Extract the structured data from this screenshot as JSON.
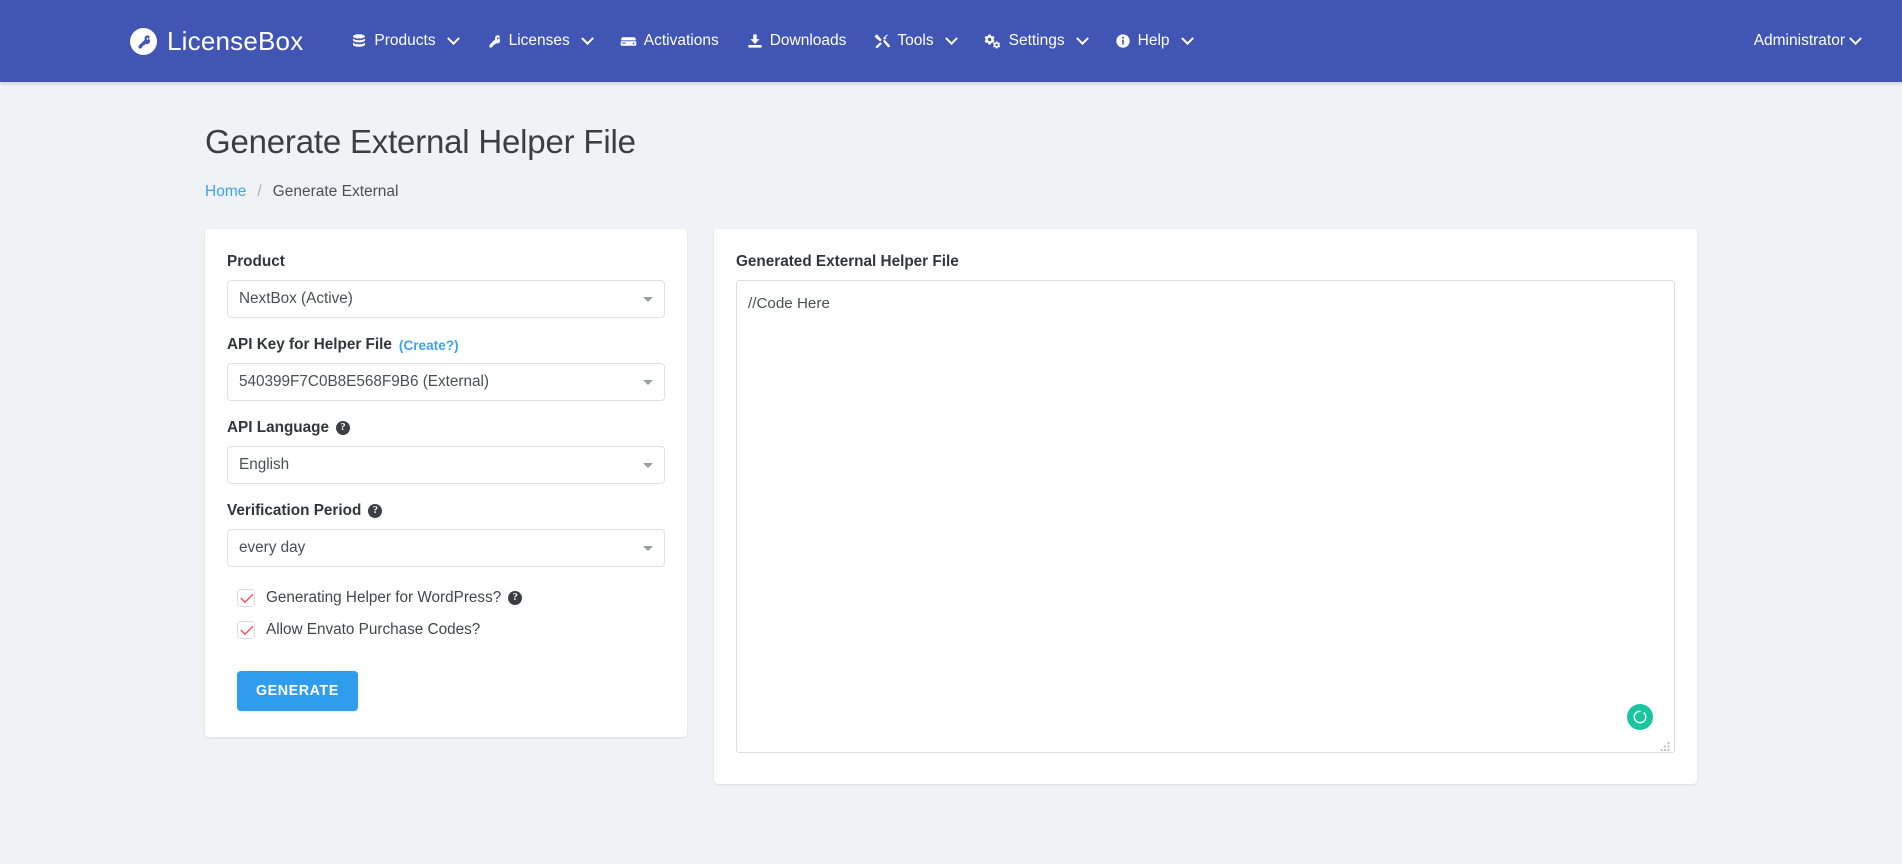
{
  "brand": {
    "name": "LicenseBox",
    "icon": "key-icon"
  },
  "navbar": {
    "background": "#4055b4",
    "items": [
      {
        "label": "Products",
        "icon": "database-icon",
        "caret": true
      },
      {
        "label": "Licenses",
        "icon": "key-icon",
        "caret": true
      },
      {
        "label": "Activations",
        "icon": "hdd-icon",
        "caret": false
      },
      {
        "label": "Downloads",
        "icon": "download-icon",
        "caret": false
      },
      {
        "label": "Tools",
        "icon": "tools-icon",
        "caret": true
      },
      {
        "label": "Settings",
        "icon": "cogs-icon",
        "caret": true
      },
      {
        "label": "Help",
        "icon": "info-circle-icon",
        "caret": true
      }
    ],
    "account": {
      "label": "Administrator",
      "caret": true
    }
  },
  "page": {
    "title": "Generate External Helper File",
    "breadcrumb": {
      "home": "Home",
      "separator": "/",
      "current": "Generate External"
    }
  },
  "form": {
    "product": {
      "label": "Product",
      "value": "NextBox (Active)"
    },
    "api_key": {
      "label": "API Key for Helper File",
      "create_link": "(Create?)",
      "value": "540399F7C0B8E568F9B6 (External)"
    },
    "api_language": {
      "label": "API Language",
      "help": "?",
      "value": "English"
    },
    "verification_period": {
      "label": "Verification Period",
      "help": "?",
      "value": "every day"
    },
    "checkbox_wordpress": {
      "label": "Generating Helper for WordPress?",
      "help": "?",
      "checked": true
    },
    "checkbox_envato": {
      "label": "Allow Envato Purchase Codes?",
      "checked": true
    },
    "submit": {
      "label": "GENERATE",
      "color": "#2f9ced"
    }
  },
  "output": {
    "label": "Generated External Helper File",
    "code": "//Code Here",
    "placeholder": "//Code Here",
    "spinner_color": "#18c79e"
  }
}
